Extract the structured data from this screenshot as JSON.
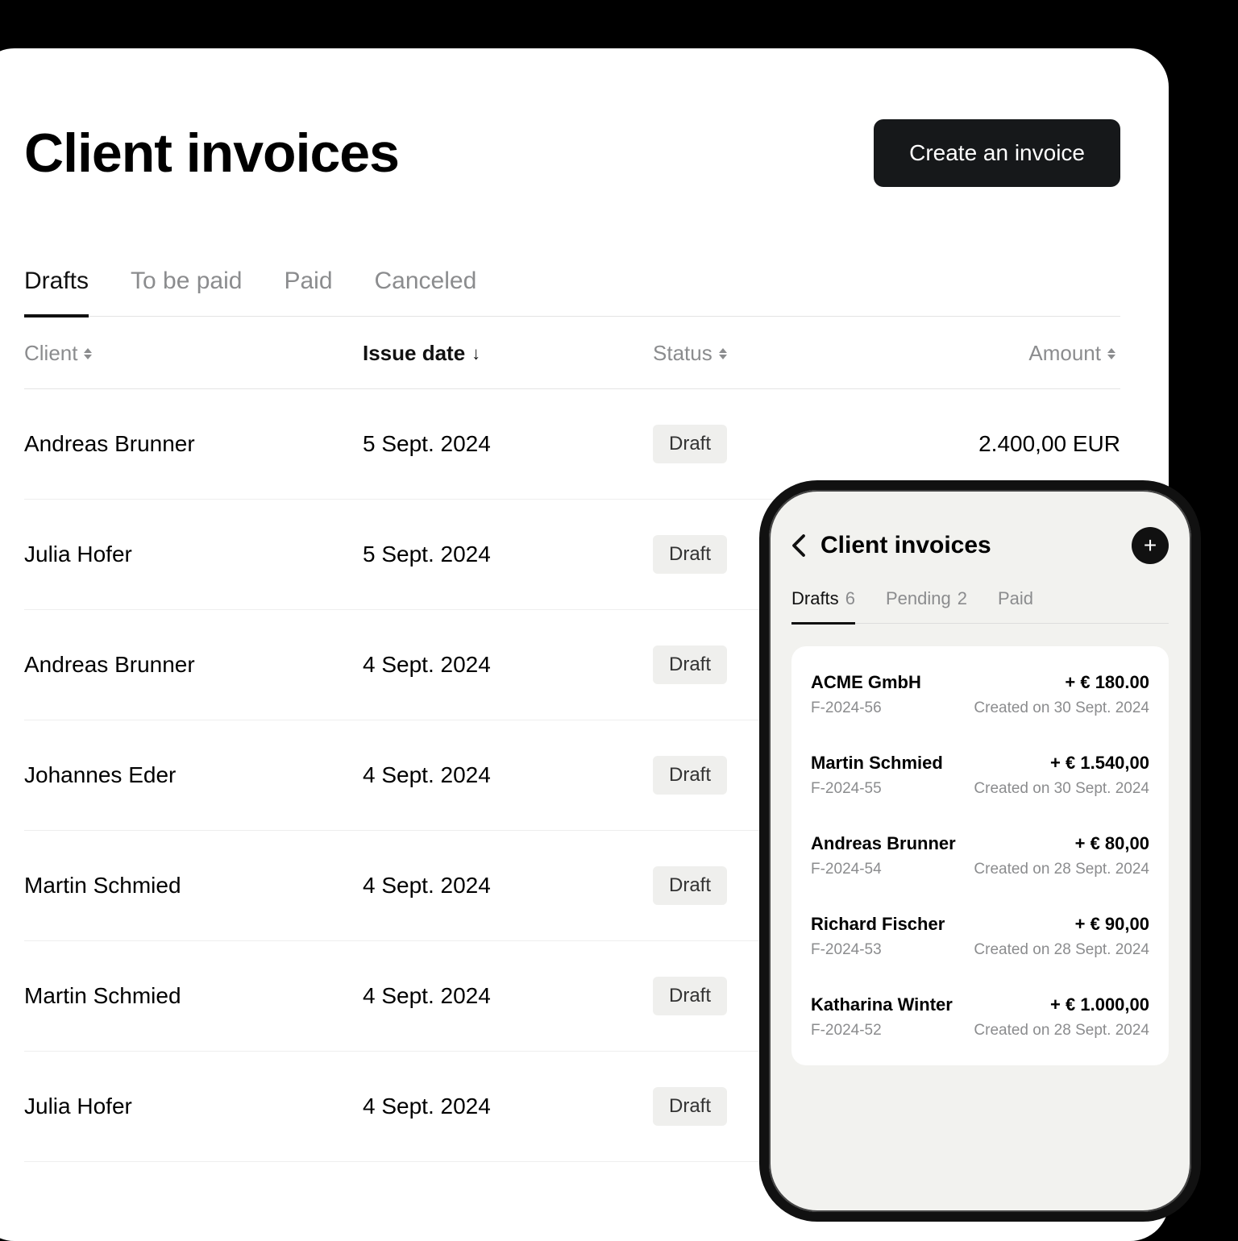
{
  "desktop": {
    "title": "Client invoices",
    "create_btn": "Create an invoice",
    "tabs": [
      "Drafts",
      "To be paid",
      "Paid",
      "Canceled"
    ],
    "active_tab": 0,
    "columns": {
      "client": "Client",
      "issue_date": "Issue date",
      "status": "Status",
      "amount": "Amount"
    },
    "rows": [
      {
        "client": "Andreas Brunner",
        "date": "5 Sept. 2024",
        "status": "Draft",
        "amount": "2.400,00 EUR"
      },
      {
        "client": "Julia Hofer",
        "date": "5 Sept. 2024",
        "status": "Draft",
        "amount": ""
      },
      {
        "client": "Andreas Brunner",
        "date": "4 Sept. 2024",
        "status": "Draft",
        "amount": ""
      },
      {
        "client": "Johannes Eder",
        "date": "4 Sept. 2024",
        "status": "Draft",
        "amount": ""
      },
      {
        "client": "Martin Schmied",
        "date": "4 Sept. 2024",
        "status": "Draft",
        "amount": ""
      },
      {
        "client": "Martin Schmied",
        "date": "4 Sept. 2024",
        "status": "Draft",
        "amount": ""
      },
      {
        "client": "Julia Hofer",
        "date": "4 Sept. 2024",
        "status": "Draft",
        "amount": ""
      }
    ]
  },
  "mobile": {
    "title": "Client invoices",
    "tabs": [
      {
        "label": "Drafts",
        "count": "6"
      },
      {
        "label": "Pending",
        "count": "2"
      },
      {
        "label": "Paid",
        "count": ""
      }
    ],
    "active_tab": 0,
    "items": [
      {
        "name": "ACME GmbH",
        "amount": "+ € 180.00",
        "ref": "F-2024-56",
        "created": "Created on 30 Sept. 2024"
      },
      {
        "name": "Martin Schmied",
        "amount": "+ € 1.540,00",
        "ref": "F-2024-55",
        "created": "Created on 30 Sept. 2024"
      },
      {
        "name": "Andreas Brunner",
        "amount": "+ € 80,00",
        "ref": "F-2024-54",
        "created": "Created on 28 Sept. 2024"
      },
      {
        "name": "Richard Fischer",
        "amount": "+ € 90,00",
        "ref": "F-2024-53",
        "created": "Created on 28 Sept. 2024"
      },
      {
        "name": "Katharina Winter",
        "amount": "+ € 1.000,00",
        "ref": "F-2024-52",
        "created": "Created on 28 Sept. 2024"
      }
    ]
  }
}
